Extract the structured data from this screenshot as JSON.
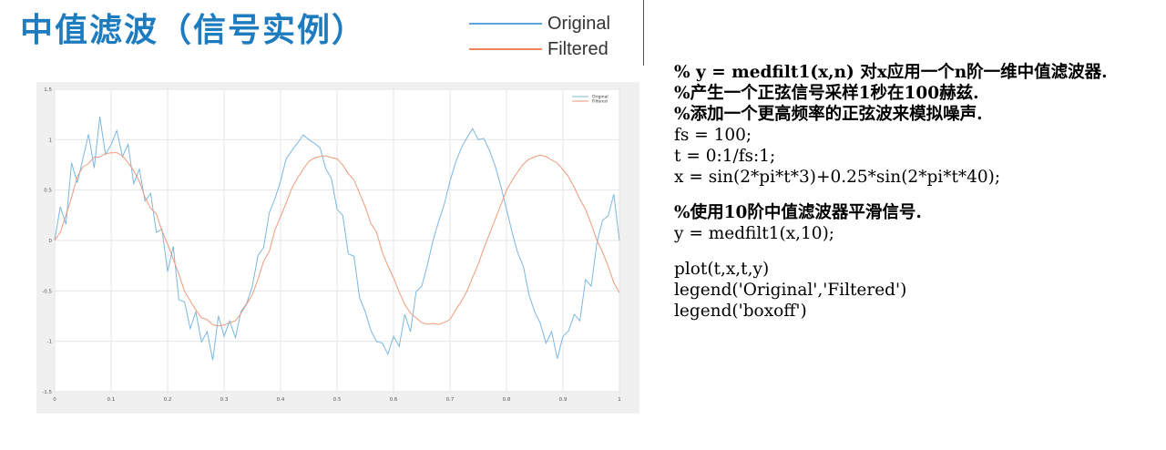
{
  "slide": {
    "title": "中值滤波（信号实例）",
    "legend": [
      {
        "label": "Original",
        "color": "#5ba6dd"
      },
      {
        "label": "Filtered",
        "color": "#ef8658"
      }
    ]
  },
  "code_lines": [
    {
      "text": "% y = medfilt1(x,n) 对x应用一个n阶一维中值滤波器.",
      "bold": true
    },
    {
      "text": "%产生一个正弦信号采样1秒在100赫兹.",
      "bold": true
    },
    {
      "text": "%添加一个更高频率的正弦波来模拟噪声.",
      "bold": true
    },
    {
      "text": "fs = 100;",
      "bold": false
    },
    {
      "text": "t = 0:1/fs:1;",
      "bold": false
    },
    {
      "text": "x = sin(2*pi*t*3)+0.25*sin(2*pi*t*40);",
      "bold": false
    },
    {
      "text": "",
      "bold": false
    },
    {
      "text": "%使用10阶中值滤波器平滑信号.",
      "bold": true
    },
    {
      "text": "y = medfilt1(x,10);",
      "bold": false
    },
    {
      "text": "",
      "bold": false
    },
    {
      "text": "plot(t,x,t,y)",
      "bold": false
    },
    {
      "text": "legend('Original','Filtered')",
      "bold": false
    },
    {
      "text": "legend('boxoff')",
      "bold": false
    }
  ],
  "chart_data": {
    "type": "line",
    "xlim": [
      0,
      1
    ],
    "ylim": [
      -1.5,
      1.5
    ],
    "x_ticks": [
      "0",
      "0.1",
      "0.2",
      "0.3",
      "0.4",
      "0.5",
      "0.6",
      "0.7",
      "0.8",
      "0.9",
      "1"
    ],
    "y_ticks": [
      "-1.5",
      "-1",
      "-0.5",
      "0",
      "0.5",
      "1",
      "1.5"
    ],
    "grid": true,
    "legend_position": "top-right",
    "series": [
      {
        "name": "Original",
        "color": "#7ab8e0",
        "x": [
          0,
          0.01,
          0.02,
          0.03,
          0.04,
          0.05,
          0.06,
          0.07,
          0.08,
          0.09,
          0.1,
          0.11,
          0.12,
          0.13,
          0.14,
          0.15,
          0.16,
          0.17,
          0.18,
          0.19,
          0.2,
          0.21,
          0.22,
          0.23,
          0.24,
          0.25,
          0.26,
          0.27,
          0.28,
          0.29,
          0.3,
          0.31,
          0.32,
          0.33,
          0.34,
          0.35,
          0.36,
          0.37,
          0.38,
          0.39,
          0.4,
          0.41,
          0.42,
          0.43,
          0.44,
          0.45,
          0.46,
          0.47,
          0.48,
          0.49,
          0.5,
          0.51,
          0.52,
          0.53,
          0.54,
          0.55,
          0.56,
          0.57,
          0.58,
          0.59,
          0.6,
          0.61,
          0.62,
          0.63,
          0.64,
          0.65,
          0.66,
          0.67,
          0.68,
          0.69,
          0.7,
          0.71,
          0.72,
          0.73,
          0.74,
          0.75,
          0.76,
          0.77,
          0.78,
          0.79,
          0.8,
          0.81,
          0.82,
          0.83,
          0.84,
          0.85,
          0.86,
          0.87,
          0.88,
          0.89,
          0.9,
          0.91,
          0.92,
          0.93,
          0.94,
          0.95,
          0.96,
          0.97,
          0.98,
          0.99,
          1
        ],
        "y": [
          0,
          0.334,
          0.161,
          0.771,
          0.572,
          0.811,
          1.054,
          0.718,
          1.228,
          0.853,
          0.951,
          1.09,
          0.832,
          0.952,
          0.566,
          0.707,
          0.39,
          0.467,
          0.08,
          0.112,
          -0.309,
          -0.059,
          -0.59,
          -0.608,
          -0.873,
          -0.707,
          -1.007,
          -0.905,
          -1.187,
          -0.747,
          -0.951,
          -0.797,
          -0.964,
          -0.702,
          -0.625,
          -0.454,
          -0.149,
          -0.069,
          0.275,
          0.415,
          0.588,
          0.812,
          0.892,
          0.966,
          1.046,
          1.0,
          0.964,
          0.92,
          0.712,
          0.616,
          0.309,
          0.252,
          -0.133,
          -0.157,
          -0.571,
          -0.707,
          -0.894,
          -1.004,
          -1.016,
          -1.128,
          -0.951,
          -1.051,
          -0.733,
          -0.905,
          -0.508,
          -0.454,
          -0.244,
          -0.0,
          0.192,
          0.361,
          0.588,
          0.775,
          0.918,
          1.02,
          1.109,
          1.0,
          1.013,
          0.892,
          0.738,
          0.541,
          0.309,
          0.082,
          -0.125,
          -0.258,
          -0.542,
          -0.707,
          -0.824,
          -1.018,
          -0.905,
          -1.172,
          -0.951,
          -0.896,
          -0.733,
          -0.797,
          -0.389,
          -0.454,
          -0.025,
          0.2,
          0.243,
          0.459,
          0.0
        ]
      },
      {
        "name": "Filtered",
        "color": "#ef9a7a",
        "x": [
          0,
          0.01,
          0.02,
          0.03,
          0.04,
          0.05,
          0.06,
          0.07,
          0.08,
          0.09,
          0.1,
          0.11,
          0.12,
          0.13,
          0.14,
          0.15,
          0.16,
          0.17,
          0.18,
          0.19,
          0.2,
          0.21,
          0.22,
          0.23,
          0.24,
          0.25,
          0.26,
          0.27,
          0.28,
          0.29,
          0.3,
          0.31,
          0.32,
          0.33,
          0.34,
          0.35,
          0.36,
          0.37,
          0.38,
          0.39,
          0.4,
          0.41,
          0.42,
          0.43,
          0.44,
          0.45,
          0.46,
          0.47,
          0.48,
          0.49,
          0.5,
          0.51,
          0.52,
          0.53,
          0.54,
          0.55,
          0.56,
          0.57,
          0.58,
          0.59,
          0.6,
          0.61,
          0.62,
          0.63,
          0.64,
          0.65,
          0.66,
          0.67,
          0.68,
          0.69,
          0.7,
          0.71,
          0.72,
          0.73,
          0.74,
          0.75,
          0.76,
          0.77,
          0.78,
          0.79,
          0.8,
          0.81,
          0.82,
          0.83,
          0.84,
          0.85,
          0.86,
          0.87,
          0.88,
          0.89,
          0.9,
          0.91,
          0.92,
          0.93,
          0.94,
          0.95,
          0.96,
          0.97,
          0.98,
          0.99,
          1
        ],
        "y": [
          0.0,
          0.081,
          0.251,
          0.428,
          0.633,
          0.73,
          0.764,
          0.826,
          0.829,
          0.862,
          0.869,
          0.871,
          0.84,
          0.772,
          0.692,
          0.587,
          0.429,
          0.318,
          0.266,
          0.096,
          -0.035,
          -0.184,
          -0.335,
          -0.503,
          -0.599,
          -0.689,
          -0.766,
          -0.786,
          -0.837,
          -0.848,
          -0.839,
          -0.813,
          -0.797,
          -0.724,
          -0.632,
          -0.538,
          -0.384,
          -0.205,
          -0.109,
          0.103,
          0.238,
          0.372,
          0.52,
          0.62,
          0.706,
          0.785,
          0.819,
          0.833,
          0.841,
          0.821,
          0.811,
          0.748,
          0.662,
          0.601,
          0.466,
          0.332,
          0.167,
          0.081,
          -0.116,
          -0.252,
          -0.37,
          -0.511,
          -0.636,
          -0.72,
          -0.768,
          -0.815,
          -0.831,
          -0.822,
          -0.833,
          -0.811,
          -0.785,
          -0.688,
          -0.605,
          -0.502,
          -0.367,
          -0.235,
          -0.075,
          0.065,
          0.21,
          0.354,
          0.498,
          0.597,
          0.681,
          0.759,
          0.807,
          0.831,
          0.846,
          0.832,
          0.8,
          0.768,
          0.703,
          0.631,
          0.528,
          0.408,
          0.308,
          0.165,
          0.002,
          -0.113,
          -0.254,
          -0.418,
          -0.518
        ]
      }
    ]
  }
}
